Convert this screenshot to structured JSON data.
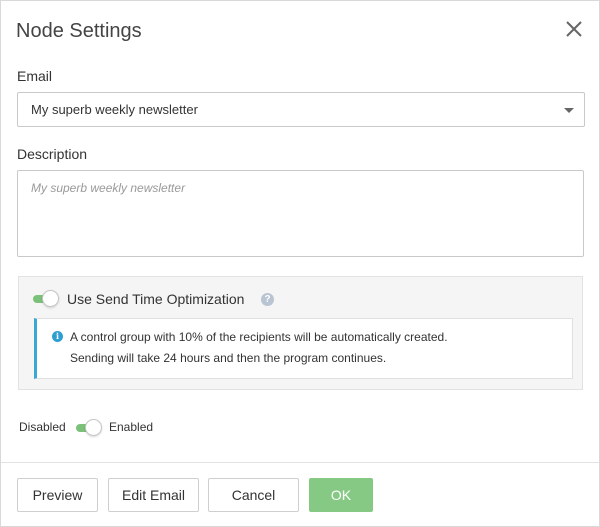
{
  "dialog": {
    "title": "Node Settings",
    "close_icon": "close-icon"
  },
  "email": {
    "label": "Email",
    "selected": "My superb weekly newsletter"
  },
  "description": {
    "label": "Description",
    "placeholder": "My superb weekly newsletter"
  },
  "send_time_optimization": {
    "label": "Use Send Time Optimization",
    "enabled": true,
    "help_icon": "help-icon",
    "info_icon": "info-icon",
    "info_line1": "A control group with 10% of the recipients will be automatically created.",
    "info_line2": "Sending will take 24 hours and then the program continues."
  },
  "state": {
    "off_label": "Disabled",
    "on_label": "Enabled",
    "enabled": true
  },
  "footer": {
    "preview": "Preview",
    "edit_email": "Edit Email",
    "cancel": "Cancel",
    "ok": "OK"
  },
  "colors": {
    "toggle_on": "#7cc17a",
    "ok_button": "#85c985",
    "info_accent": "#3aa7d4"
  }
}
